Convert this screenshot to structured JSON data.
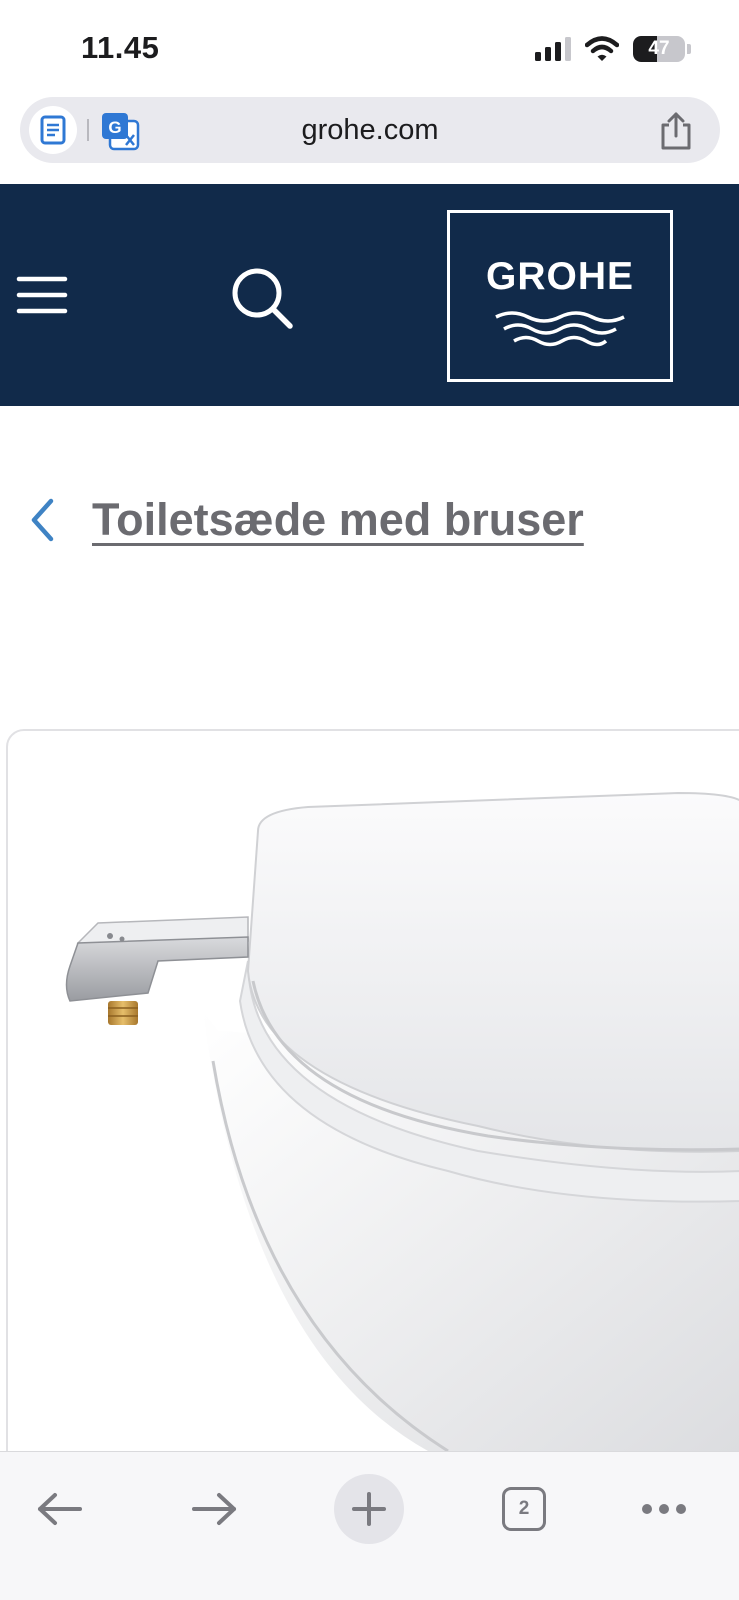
{
  "status_bar": {
    "time": "11.45",
    "battery_level": "47",
    "battery_percent": 47,
    "icons": [
      "cellular-signal-icon",
      "wifi-icon",
      "battery-icon"
    ]
  },
  "browser": {
    "url": "grohe.com",
    "icons": [
      "reader-mode-icon",
      "translate-icon",
      "share-icon"
    ],
    "open_tabs": "2",
    "toolbar_icons": [
      "back-arrow-icon",
      "forward-arrow-icon",
      "plus-icon",
      "tabs-icon",
      "more-icon"
    ]
  },
  "site_header": {
    "logo_text": "GROHE",
    "background_color": "#112a4a",
    "icons": [
      "hamburger-menu-icon",
      "search-icon",
      "grohe-waves-logo"
    ]
  },
  "breadcrumb": {
    "back_label": "Toiletsæde med bruser",
    "chevron_color": "#3f83c4",
    "icon": "chevron-left-icon"
  },
  "product": {
    "image": "toilet-seat-with-bidet-arm-image"
  }
}
